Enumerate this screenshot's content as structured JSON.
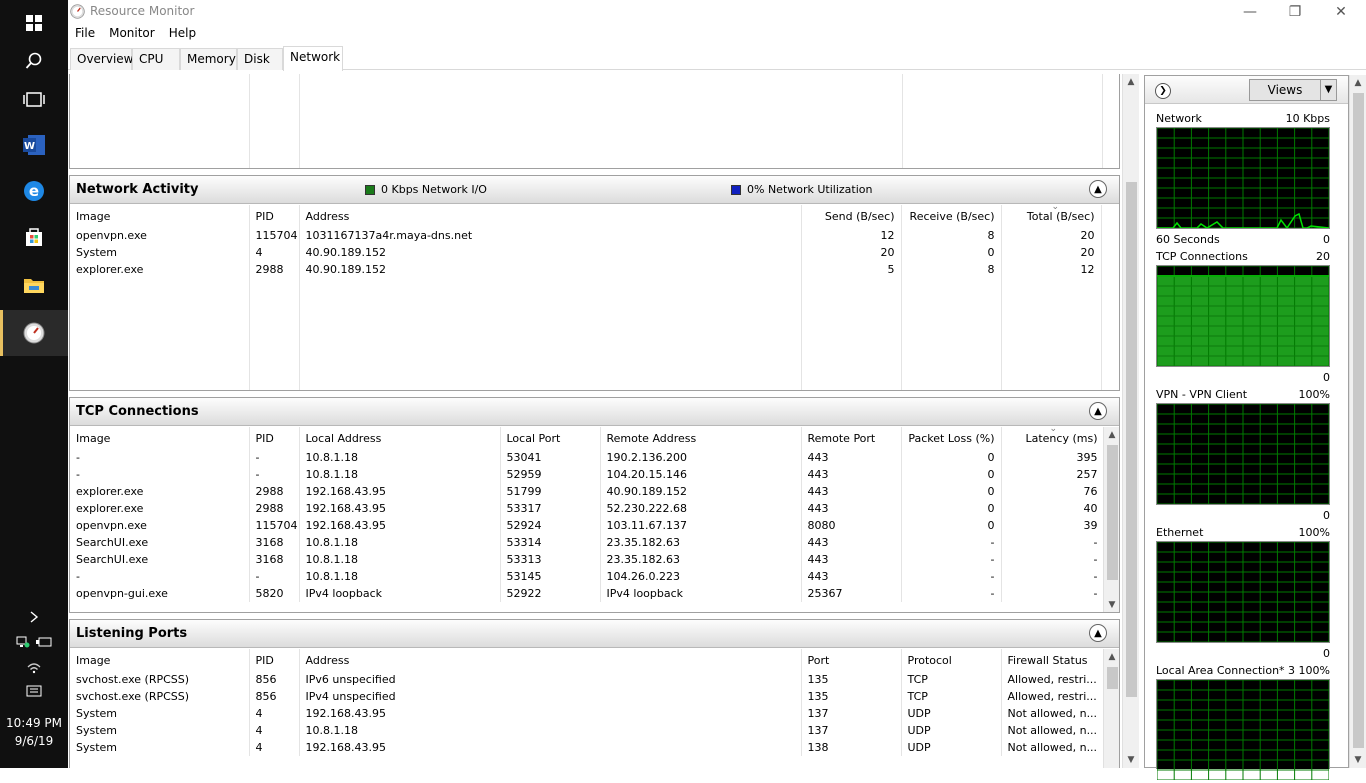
{
  "taskbar": {
    "clock_time": "10:49 PM",
    "clock_date": "9/6/19",
    "icons": [
      "windows-start-icon",
      "search-icon",
      "task-view-icon",
      "word-icon",
      "edge-icon",
      "store-icon",
      "file-explorer-icon",
      "resource-monitor-icon"
    ]
  },
  "window": {
    "title": "Resource Monitor",
    "menu": [
      "File",
      "Monitor",
      "Help"
    ],
    "tabs": [
      "Overview",
      "CPU",
      "Memory",
      "Disk",
      "Network"
    ],
    "selected_tab": "Network"
  },
  "network_activity": {
    "title": "Network Activity",
    "io_legend": "0 Kbps Network I/O",
    "util_legend": "0% Network Utilization",
    "io_color": "#1a7a1a",
    "util_color": "#1020c0",
    "columns": [
      "Image",
      "PID",
      "Address",
      "Send (B/sec)",
      "Receive (B/sec)",
      "Total (B/sec)"
    ],
    "rows": [
      [
        "openvpn.exe",
        "115704",
        "1031167137a4r.maya-dns.net",
        "12",
        "8",
        "20"
      ],
      [
        "System",
        "4",
        "40.90.189.152",
        "20",
        "0",
        "20"
      ],
      [
        "explorer.exe",
        "2988",
        "40.90.189.152",
        "5",
        "8",
        "12"
      ]
    ]
  },
  "tcp_connections": {
    "title": "TCP Connections",
    "columns": [
      "Image",
      "PID",
      "Local Address",
      "Local Port",
      "Remote Address",
      "Remote Port",
      "Packet Loss (%)",
      "Latency (ms)"
    ],
    "rows": [
      [
        "-",
        "-",
        "10.8.1.18",
        "53041",
        "190.2.136.200",
        "443",
        "0",
        "395"
      ],
      [
        "-",
        "-",
        "10.8.1.18",
        "52959",
        "104.20.15.146",
        "443",
        "0",
        "257"
      ],
      [
        "explorer.exe",
        "2988",
        "192.168.43.95",
        "51799",
        "40.90.189.152",
        "443",
        "0",
        "76"
      ],
      [
        "explorer.exe",
        "2988",
        "192.168.43.95",
        "53317",
        "52.230.222.68",
        "443",
        "0",
        "40"
      ],
      [
        "openvpn.exe",
        "115704",
        "192.168.43.95",
        "52924",
        "103.11.67.137",
        "8080",
        "0",
        "39"
      ],
      [
        "SearchUI.exe",
        "3168",
        "10.8.1.18",
        "53314",
        "23.35.182.63",
        "443",
        "-",
        "-"
      ],
      [
        "SearchUI.exe",
        "3168",
        "10.8.1.18",
        "53313",
        "23.35.182.63",
        "443",
        "-",
        "-"
      ],
      [
        "-",
        "-",
        "10.8.1.18",
        "53145",
        "104.26.0.223",
        "443",
        "-",
        "-"
      ],
      [
        "openvpn-gui.exe",
        "5820",
        "IPv4 loopback",
        "52922",
        "IPv4 loopback",
        "25367",
        "-",
        "-"
      ]
    ]
  },
  "listening_ports": {
    "title": "Listening Ports",
    "columns": [
      "Image",
      "PID",
      "Address",
      "Port",
      "Protocol",
      "Firewall Status"
    ],
    "rows": [
      [
        "svchost.exe (RPCSS)",
        "856",
        "IPv6 unspecified",
        "135",
        "TCP",
        "Allowed, restri..."
      ],
      [
        "svchost.exe (RPCSS)",
        "856",
        "IPv4 unspecified",
        "135",
        "TCP",
        "Allowed, restri..."
      ],
      [
        "System",
        "4",
        "192.168.43.95",
        "137",
        "UDP",
        "Not allowed, n..."
      ],
      [
        "System",
        "4",
        "10.8.1.18",
        "137",
        "UDP",
        "Not allowed, n..."
      ],
      [
        "System",
        "4",
        "192.168.43.95",
        "138",
        "UDP",
        "Not allowed, n..."
      ]
    ]
  },
  "right_pane": {
    "views_label": "Views",
    "graphs": [
      {
        "title": "Network",
        "max": "10 Kbps",
        "min_left": "60 Seconds",
        "min_right": "0"
      },
      {
        "title": "TCP Connections",
        "max": "20",
        "min_left": "",
        "min_right": "0"
      },
      {
        "title": "VPN - VPN Client",
        "max": "100%",
        "min_left": "",
        "min_right": "0"
      },
      {
        "title": "Ethernet",
        "max": "100%",
        "min_left": "",
        "min_right": "0"
      },
      {
        "title": "Local Area Connection* 3",
        "max": "100%",
        "min_left": "",
        "min_right": ""
      }
    ],
    "graph_line_color": "#00e000",
    "graph_grid_color": "#007a00",
    "tcp_connections_level_fraction": 0.9
  }
}
